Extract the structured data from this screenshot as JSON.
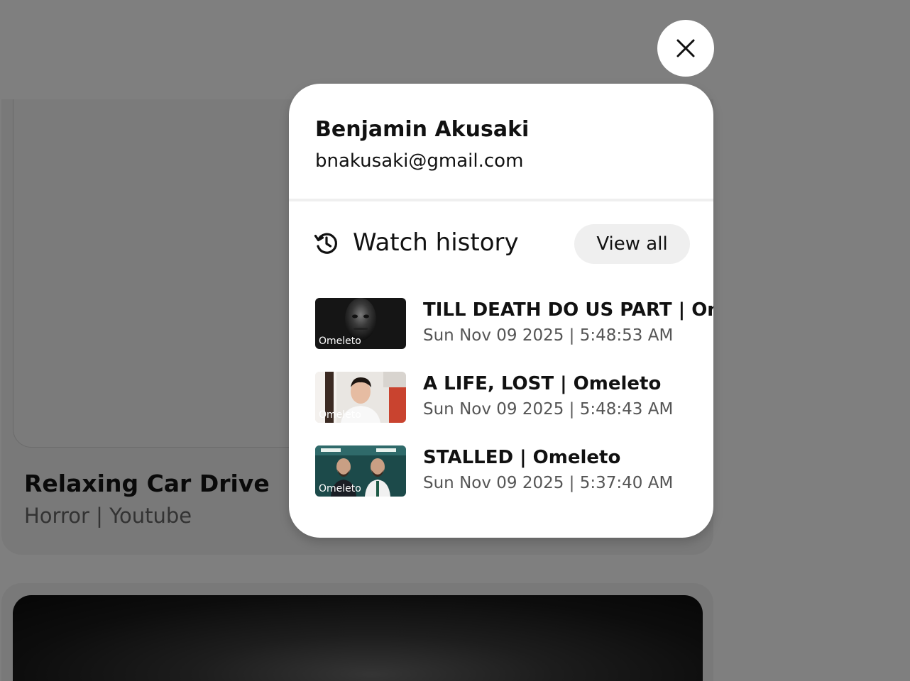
{
  "background": {
    "card": {
      "title": "Relaxing Car Drive",
      "subtitle": "Horror | Youtube"
    }
  },
  "popup": {
    "user": {
      "name": "Benjamin Akusaki",
      "email": "bnakusaki@gmail.com"
    },
    "watch_history": {
      "title": "Watch history",
      "view_all_label": "View all",
      "icon": "history-icon",
      "items": [
        {
          "title": "TILL DEATH DO US PART | Omeleto",
          "time": "Sun Nov 09 2025 | 5:48:53 AM",
          "thumb_label": "Omeleto"
        },
        {
          "title": "A LIFE, LOST | Omeleto",
          "time": "Sun Nov 09 2025 | 5:48:43 AM",
          "thumb_label": "Omeleto"
        },
        {
          "title": "STALLED | Omeleto",
          "time": "Sun Nov 09 2025 | 5:37:40 AM",
          "thumb_label": "Omeleto"
        }
      ]
    }
  },
  "close_button": {
    "icon": "close-icon"
  }
}
